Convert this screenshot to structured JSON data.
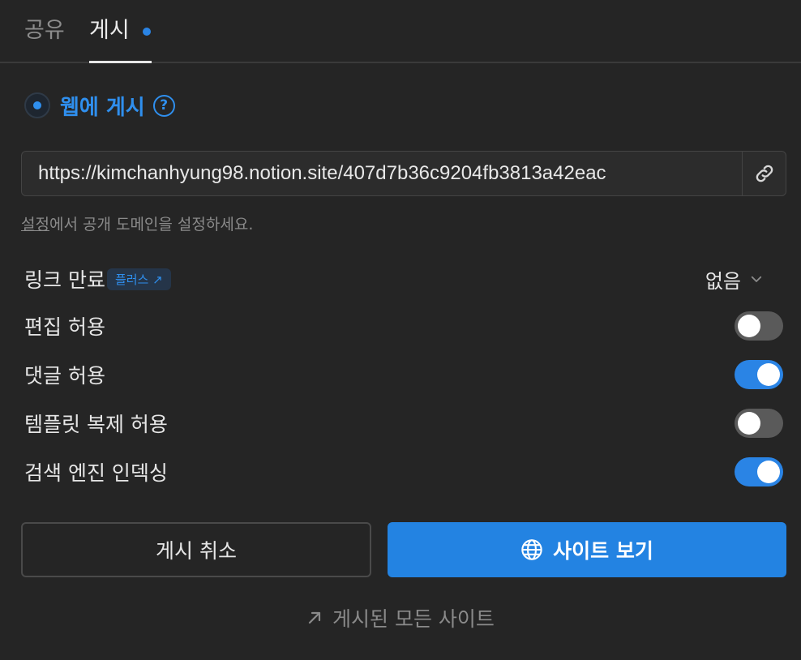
{
  "tabs": {
    "share": "공유",
    "publish": "게시"
  },
  "status": {
    "label": "웹에 게시",
    "help": "?"
  },
  "url": "https://kimchanhyung98.notion.site/407d7b36c9204fb3813a42eac",
  "hint": {
    "link": "설정",
    "text": "에서 공개 도메인을 설정하세요."
  },
  "expiry": {
    "label": "링크 만료",
    "badge": "플러스 ↗",
    "value": "없음"
  },
  "settings": [
    {
      "label": "편집 허용",
      "on": false
    },
    {
      "label": "댓글 허용",
      "on": true
    },
    {
      "label": "템플릿 복제 허용",
      "on": false
    },
    {
      "label": "검색 엔진 인덱싱",
      "on": true
    }
  ],
  "buttons": {
    "unpublish": "게시 취소",
    "view_site": "사이트 보기"
  },
  "footer": {
    "all_sites": "게시된 모든 사이트"
  },
  "colors": {
    "accent": "#2383e2",
    "background": "#252525"
  }
}
